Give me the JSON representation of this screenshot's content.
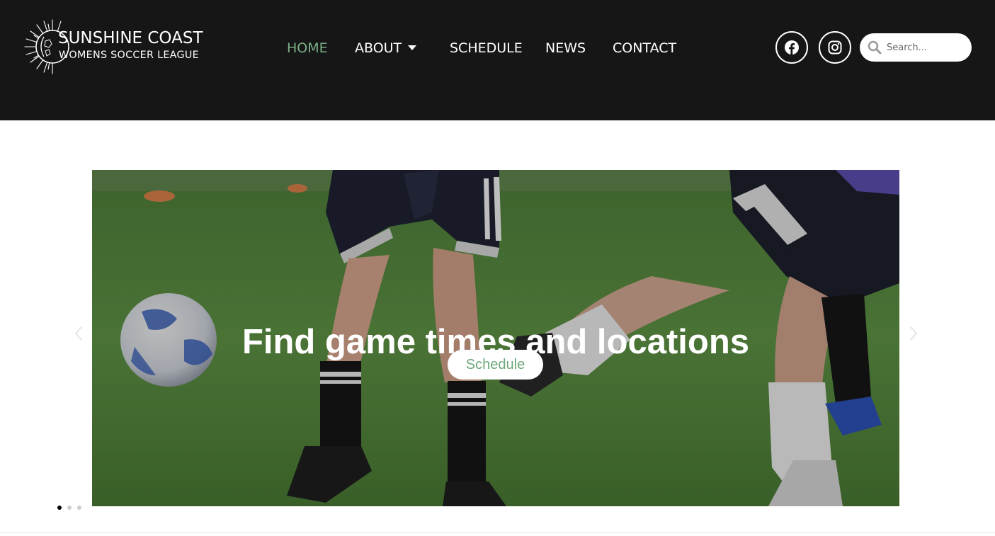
{
  "header": {
    "logo": {
      "title": "SUNSHINE COAST",
      "subtitle": "WOMENS SOCCER LEAGUE"
    },
    "nav": {
      "home": "HOME",
      "about": "ABOUT",
      "schedule": "SCHEDULE",
      "news": "NEWS",
      "contact": "CONTACT",
      "active_item": "HOME"
    },
    "social": {
      "facebook_icon": "facebook-icon",
      "instagram_icon": "instagram-icon"
    },
    "search": {
      "placeholder": "Search...",
      "value": ""
    }
  },
  "hero": {
    "heading": "Find game times and locations",
    "button_label": "Schedule",
    "slide_count": 3,
    "active_slide": 1,
    "prev_icon": "chevron-left-icon",
    "next_icon": "chevron-right-icon"
  },
  "colors": {
    "header_bg": "#161616",
    "accent_green": "#7aaf85",
    "button_text_green": "#6ea77a",
    "page_bg": "#ffffff"
  }
}
